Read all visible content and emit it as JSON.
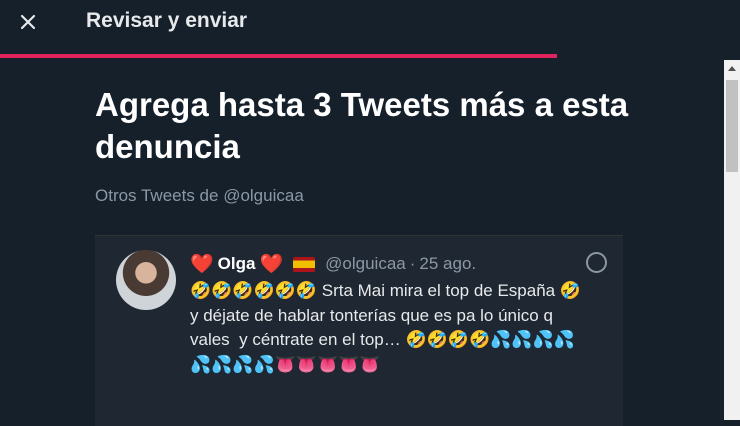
{
  "header": {
    "title": "Revisar y enviar",
    "close_icon": "close-icon",
    "progress_percent": 75
  },
  "main": {
    "heading": "Agrega hasta 3 Tweets más a esta denuncia",
    "subtitle": "Otros Tweets de @olguicaa"
  },
  "tweet": {
    "heart_left": "❤️",
    "name": "Olga",
    "heart_right": "❤️",
    "flag": "🇪🇸",
    "handle": "@olguicaa",
    "separator": "·",
    "date": "25 ago.",
    "text": "🤣🤣🤣🤣🤣🤣 Srta Mai mira el top de España 🤣 y déjate de hablar tonterías que es pa lo único q vales  y céntrate en el top… 🤣🤣🤣🤣💦💦💦💦💦💦💦💦👅👅👅👅👅"
  },
  "colors": {
    "background": "#15202b",
    "accent": "#e0245e",
    "muted": "#8b98a5",
    "card": "#1e2732"
  }
}
